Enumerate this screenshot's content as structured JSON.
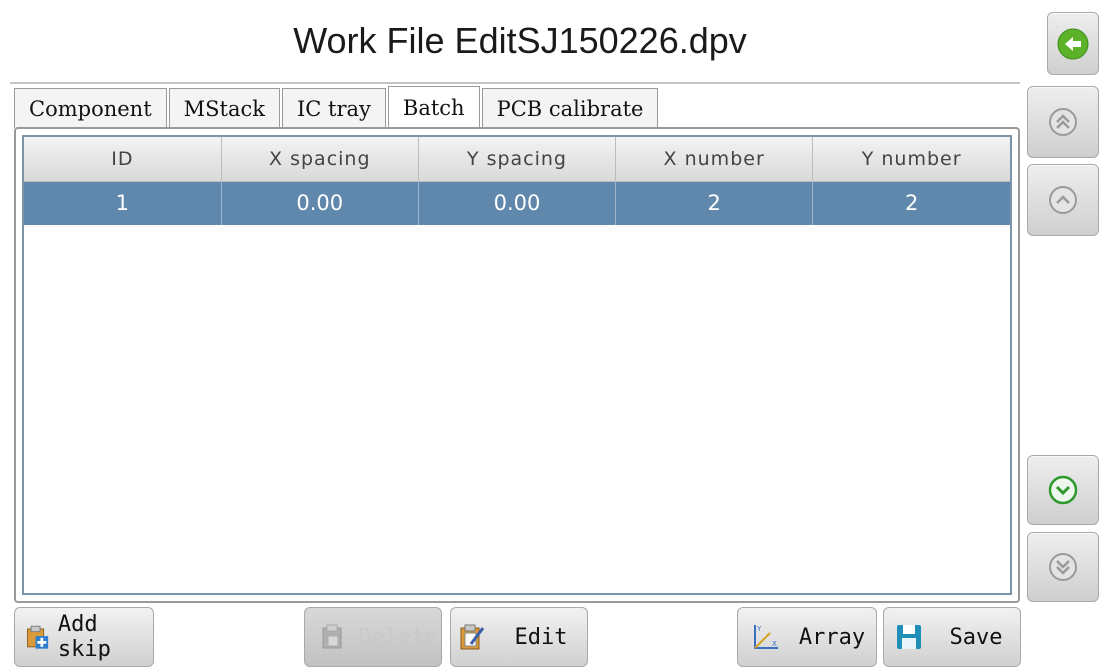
{
  "window": {
    "title": "Work File EditSJ150226.dpv"
  },
  "tabs": [
    {
      "label": "Component",
      "active": false
    },
    {
      "label": "MStack",
      "active": false
    },
    {
      "label": "IC tray",
      "active": false
    },
    {
      "label": "Batch",
      "active": true
    },
    {
      "label": "PCB calibrate",
      "active": false
    }
  ],
  "table": {
    "columns": [
      "ID",
      "X spacing",
      "Y spacing",
      "X number",
      "Y number"
    ],
    "rows": [
      {
        "id": "1",
        "x_spacing": "0.00",
        "y_spacing": "0.00",
        "x_number": "2",
        "y_number": "2"
      }
    ]
  },
  "toolbar": {
    "add_skip": "Add skip",
    "delete": "Delete",
    "edit": "Edit",
    "array": "Array",
    "save": "Save"
  },
  "side_nav": {
    "icons": [
      "back-arrow-icon",
      "double-chevron-up-icon",
      "chevron-up-icon",
      "chevron-down-icon",
      "double-chevron-down-icon"
    ]
  },
  "colors": {
    "selected_row": "#5f88ac",
    "back_icon": "#5cb32a",
    "down_icon_active": "#2e9a2e"
  }
}
